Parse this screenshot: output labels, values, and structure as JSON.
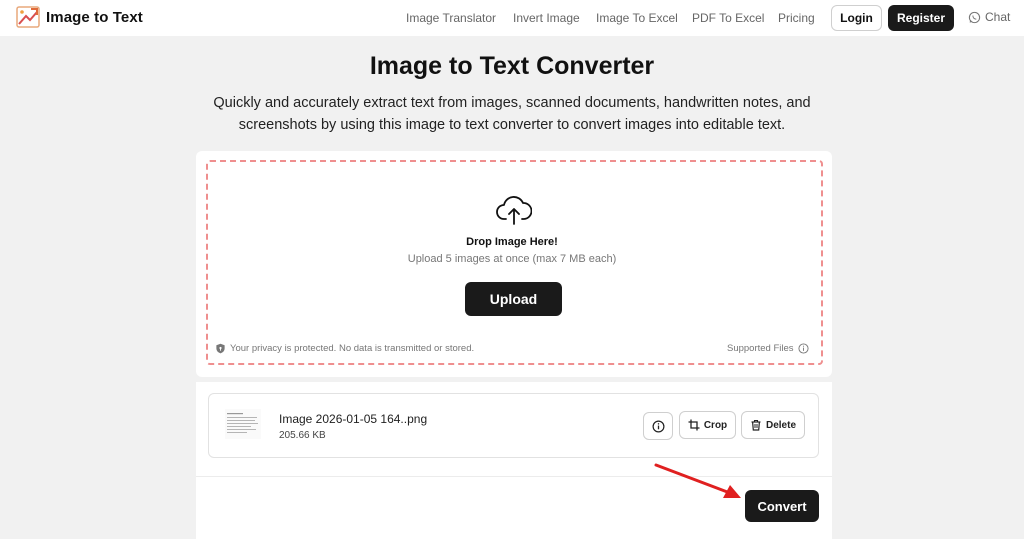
{
  "header": {
    "brand_name": "Image to Text",
    "nav": [
      {
        "label": "Image Translator"
      },
      {
        "label": "Invert Image"
      },
      {
        "label": "Image To Excel"
      },
      {
        "label": "PDF To Excel"
      },
      {
        "label": "Pricing"
      }
    ],
    "login_label": "Login",
    "register_label": "Register",
    "chat_label": "Chat"
  },
  "main": {
    "title": "Image to Text Converter",
    "subtitle": "Quickly and accurately extract text from images, scanned documents, handwritten notes, and screenshots by using this image to text converter to convert images into editable text."
  },
  "dropzone": {
    "title": "Drop Image Here!",
    "subtitle": "Upload 5 images at once (max 7 MB each)",
    "upload_label": "Upload",
    "privacy_text": "Your privacy is protected. No data is transmitted or stored.",
    "supported_label": "Supported Files"
  },
  "file": {
    "name": "Image 2026-01-05 164..png",
    "size": "205.66 KB",
    "crop_label": "Crop",
    "delete_label": "Delete"
  },
  "actions": {
    "convert_label": "Convert"
  },
  "colors": {
    "accent_dark": "#1a1a1a",
    "dropzone_border": "#ef8f8f",
    "annotation_arrow": "#e02020",
    "background": "#f1f1f1"
  },
  "icons": {
    "logo": "image-to-text-logo",
    "chat": "whatsapp-chat-icon",
    "upload": "cloud-upload-icon",
    "privacy": "shield-icon",
    "supported": "info-circle-icon",
    "info": "info-circle-icon",
    "crop": "crop-icon",
    "delete": "trash-icon"
  }
}
